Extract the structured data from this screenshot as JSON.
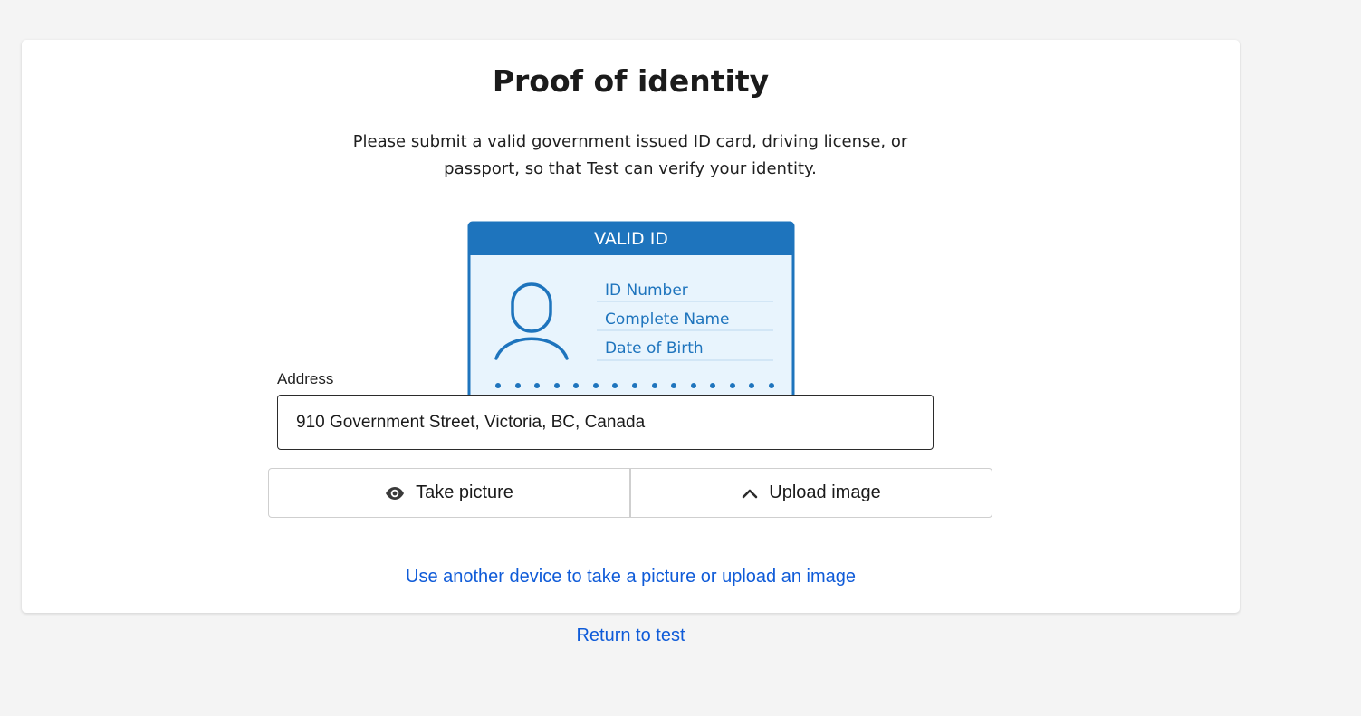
{
  "page": {
    "title": "Proof of identity",
    "description": "Please submit a valid government issued ID card, driving license, or passport, so that Test can verify your identity."
  },
  "id_card": {
    "header": "VALID ID",
    "fields": [
      "ID Number",
      "Complete Name",
      "Date of Birth"
    ],
    "color_primary": "#1e74bd",
    "color_fill": "#e8f4fd"
  },
  "address": {
    "label": "Address",
    "value": "910 Government Street, Victoria, BC, Canada"
  },
  "buttons": {
    "take_picture": "Take picture",
    "take_picture_icon": "eye-icon",
    "upload_image": "Upload image",
    "upload_image_icon": "chevron-up-icon"
  },
  "links": {
    "other_device": "Use another device to take a picture or upload an image",
    "return": "Return to test"
  },
  "colors": {
    "link": "#0f5bd8",
    "background": "#f4f4f4"
  }
}
